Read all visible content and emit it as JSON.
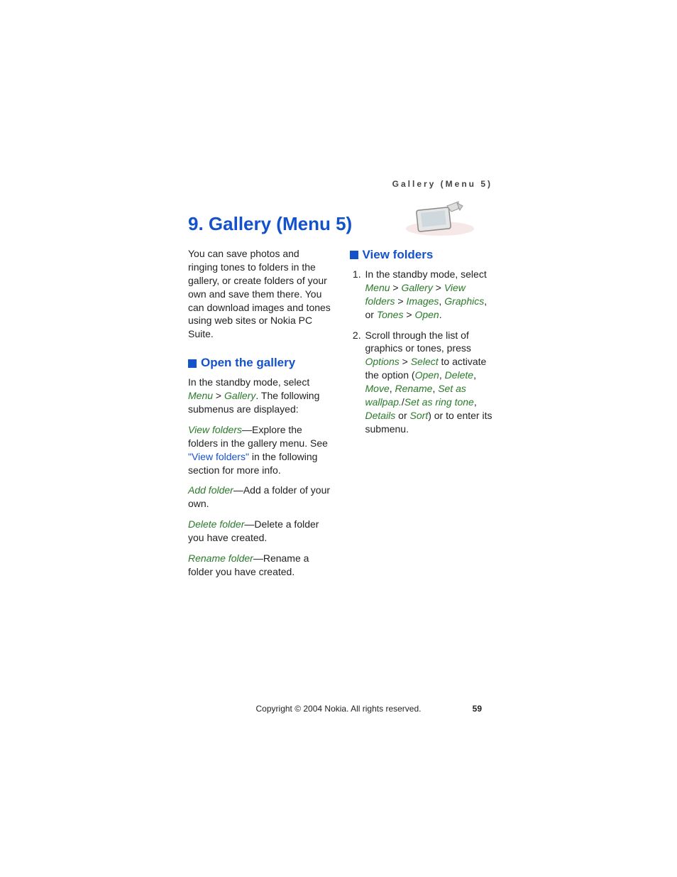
{
  "running_head": "Gallery (Menu 5)",
  "chapter_title": "9. Gallery (Menu 5)",
  "intro": "You can save photos and ringing tones to folders in the gallery, or create folders of your own and save them there. You can download images and tones using web sites or Nokia PC Suite.",
  "sections": {
    "open_gallery": {
      "heading": "Open the gallery",
      "lead_pre": "In the standby mode, select ",
      "menu1": "Menu",
      "gt1": " > ",
      "menu2": "Gallery",
      "lead_post": ". The following submenus are displayed:",
      "items": {
        "view_folders": {
          "term": "View folders",
          "desc_pre": "—Explore the folders in the gallery menu. See ",
          "link": "\"View folders\"",
          "desc_post": " in the following section for more info."
        },
        "add_folder": {
          "term": "Add folder",
          "desc": "—Add a folder of your own."
        },
        "delete_folder": {
          "term": "Delete folder",
          "desc": "—Delete a folder you have created."
        },
        "rename_folder": {
          "term": "Rename folder",
          "desc": "—Rename a folder you have created."
        }
      }
    },
    "view_folders": {
      "heading": "View folders",
      "step1": {
        "pre": "In the standby mode, select ",
        "m_menu": "Menu",
        "m_gallery": "Gallery",
        "m_viewfolders": "View folders",
        "m_images": "Images",
        "m_graphics": "Graphics",
        "or": ", or ",
        "m_tones": "Tones",
        "m_open": "Open",
        "gt": " > ",
        "comma": ", ",
        "period": "."
      },
      "step2": {
        "pre": "Scroll through the list of graphics or tones, press ",
        "m_options": "Options",
        "gt": " > ",
        "m_select": "Select",
        "mid": " to activate the option (",
        "opts": {
          "open": "Open",
          "delete": "Delete",
          "move": "Move",
          "rename": "Rename",
          "setwall": "Set as wallpap.",
          "setring": "Set as ring tone",
          "details": "Details",
          "sort": "Sort"
        },
        "sep": ", ",
        "slash": "/",
        "or": " or ",
        "post": ") or to enter its submenu."
      }
    }
  },
  "footer": "Copyright © 2004 Nokia. All rights reserved.",
  "page_number": "59"
}
